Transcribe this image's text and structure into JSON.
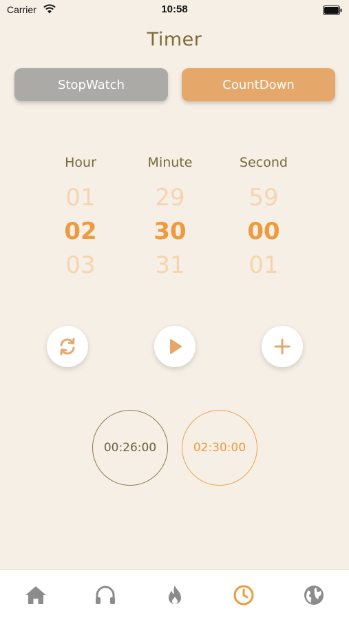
{
  "status_bar": {
    "carrier": "Carrier",
    "time": "10:58"
  },
  "header": {
    "title": "Timer"
  },
  "mode_tabs": {
    "stopwatch": "StopWatch",
    "countdown": "CountDown",
    "active": "countdown"
  },
  "picker": {
    "labels": {
      "hour": "Hour",
      "minute": "Minute",
      "second": "Second"
    },
    "hour": {
      "prev": "01",
      "selected": "02",
      "next": "03"
    },
    "minute": {
      "prev": "29",
      "selected": "30",
      "next": "31"
    },
    "second": {
      "prev": "59",
      "selected": "00",
      "next": "01"
    }
  },
  "controls": {
    "reset_icon": "refresh-icon",
    "play_icon": "play-icon",
    "add_icon": "plus-icon"
  },
  "records": [
    "00:26:00",
    "02:30:00"
  ],
  "tab_bar": {
    "items": [
      "home-icon",
      "headphones-icon",
      "flame-icon",
      "clock-icon",
      "globe-icon"
    ],
    "active": "clock-icon"
  },
  "colors": {
    "background": "#f5efe6",
    "accent": "#ee9a3d",
    "title": "#7e6a35",
    "inactive": "#acaaa7"
  }
}
